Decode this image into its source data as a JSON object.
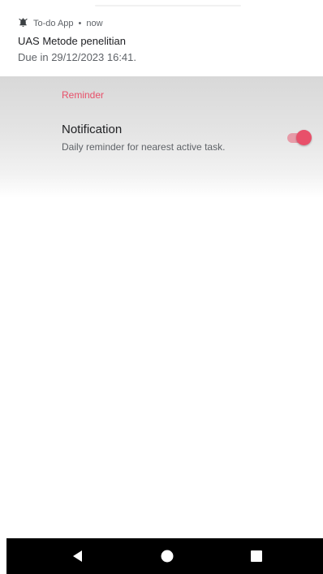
{
  "notification": {
    "app_name": "To-do App",
    "separator": "•",
    "time": "now",
    "icon": "alarm-bell-icon",
    "title": "UAS Metode penelitian",
    "body": "Due in 29/12/2023 16:41."
  },
  "settings": {
    "category": "Reminder",
    "preference": {
      "title": "Notification",
      "summary": "Daily reminder for nearest active task.",
      "enabled": true
    }
  },
  "navbar": {
    "back_icon": "back-triangle-icon",
    "home_icon": "home-circle-icon",
    "recents_icon": "recents-square-icon"
  },
  "colors": {
    "accent": "#e8506a",
    "navbar": "#000000"
  }
}
